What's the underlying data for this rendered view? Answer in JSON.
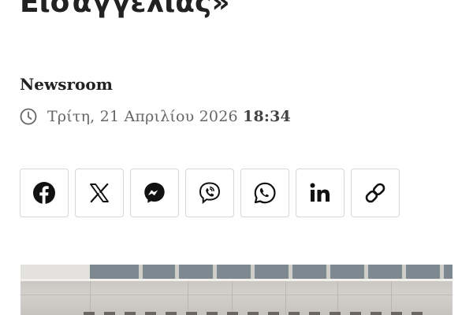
{
  "article": {
    "title_fragment": "Εισαγγελίας»",
    "author": "Newsroom",
    "date_text": "Τρίτη, 21 Απριλίου 2026",
    "time_text": "18:34"
  },
  "share": {
    "buttons": [
      {
        "icon": "facebook-icon"
      },
      {
        "icon": "x-twitter-icon"
      },
      {
        "icon": "messenger-icon"
      },
      {
        "icon": "viber-icon"
      },
      {
        "icon": "whatsapp-icon"
      },
      {
        "icon": "linkedin-icon"
      },
      {
        "icon": "copy-link-icon"
      }
    ]
  },
  "colors": {
    "text": "#222222",
    "meta": "#666666",
    "button_border": "#d6d6d6"
  }
}
